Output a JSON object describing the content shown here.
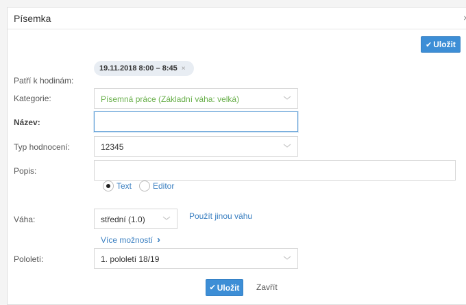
{
  "modal": {
    "title": "Písemka",
    "close_glyph": "×"
  },
  "toolbar": {
    "save_label": "Uložit",
    "check_glyph": "✔"
  },
  "form": {
    "lesson_label": "Patří k hodinám:",
    "lesson_chip": "19.11.2018 8:00 – 8:45",
    "chip_remove_glyph": "×",
    "category_label": "Kategorie:",
    "category_value": "Písemná práce (Základní váha: velká)",
    "name_label": "Název:",
    "name_value": "",
    "eval_type_label": "Typ hodnocení:",
    "eval_type_value": "12345",
    "description_label": "Popis:",
    "description_value": "",
    "radio_text_label": "Text",
    "radio_editor_label": "Editor",
    "weight_label": "Váha:",
    "weight_value": "střední (1.0)",
    "other_weight_link": "Použít jinou váhu",
    "more_options_link": "Více možností",
    "more_options_chevron": "›",
    "semester_label": "Pololetí:",
    "semester_value": "1. pololetí 18/19"
  },
  "footer": {
    "save_label": "Uložit",
    "close_label": "Zavřít"
  },
  "colors": {
    "primary": "#3d8ed6",
    "link": "#3a7fc1",
    "category_text": "#6ab04c"
  },
  "icons": [
    "close-icon",
    "check-icon",
    "chevron-down-icon",
    "chevron-right-icon",
    "remove-chip-icon"
  ]
}
